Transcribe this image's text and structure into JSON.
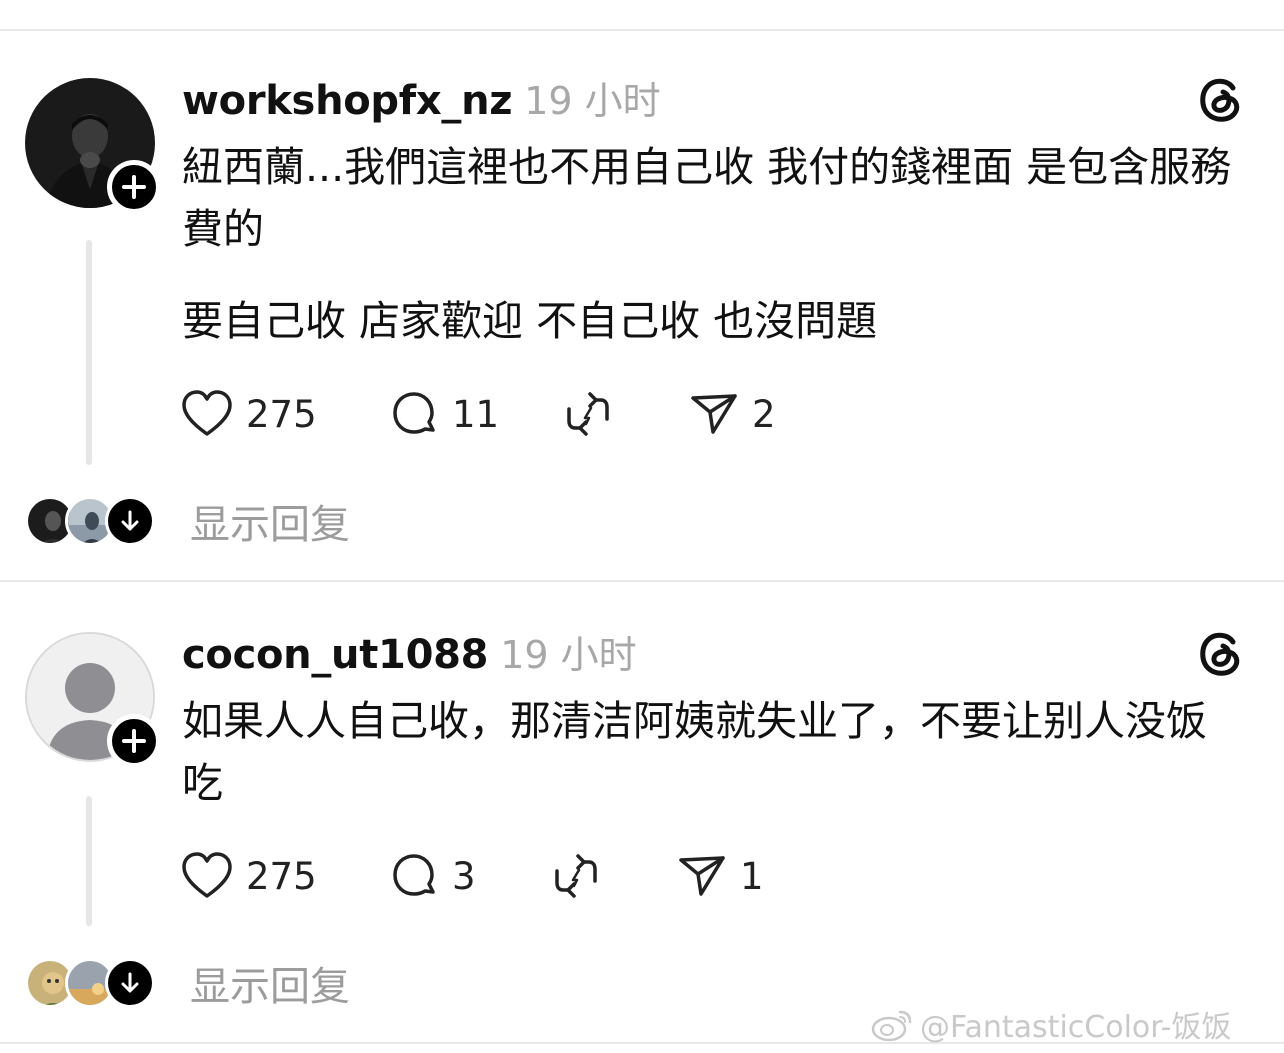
{
  "posts": [
    {
      "username": "workshopfx_nz",
      "time": "19 小时",
      "avatar_icon": "photo-avatar",
      "paragraphs": [
        "紐西蘭...我們這裡也不用自己收 我付的錢裡面 是包含服務費的",
        "要自己收 店家歡迎 不自己收 也沒問題"
      ],
      "likes": "275",
      "comments": "11",
      "shares": "2",
      "show_replies": "显示回复"
    },
    {
      "username": "cocon_ut1088",
      "time": "19 小时",
      "avatar_icon": "default-person-avatar",
      "paragraphs": [
        "如果人人自己收，那清洁阿姨就失业了，不要让别人没饭吃"
      ],
      "likes": "275",
      "comments": "3",
      "shares": "1",
      "show_replies": "显示回复"
    }
  ],
  "watermark": "@FantasticColor-饭饭",
  "colors": {
    "background": "#ffffff",
    "text": "#111111",
    "muted": "#a8a8a8",
    "divider": "#e8e8e8"
  }
}
